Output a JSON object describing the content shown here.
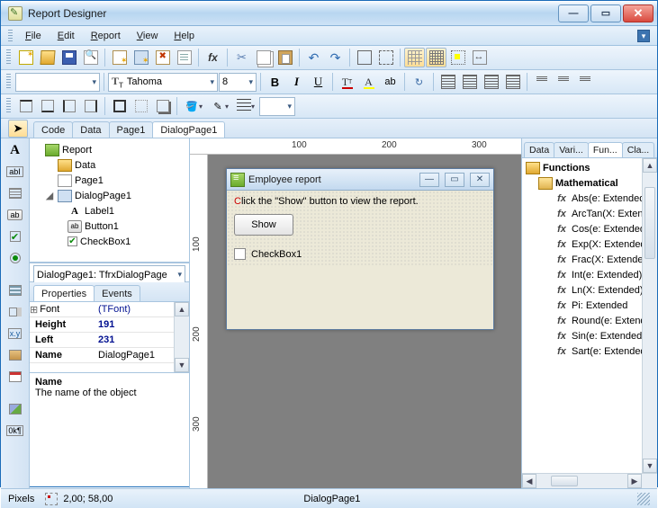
{
  "window": {
    "title": "Report Designer"
  },
  "menu": {
    "file": "File",
    "edit": "Edit",
    "report": "Report",
    "view": "View",
    "help": "Help"
  },
  "formatbar": {
    "font_name": "Tahoma",
    "font_size": "8",
    "bold": "B",
    "italic": "I",
    "underline": "U"
  },
  "tabs": {
    "code": "Code",
    "data": "Data",
    "page1": "Page1",
    "dialogpage1": "DialogPage1"
  },
  "tree": {
    "report": "Report",
    "data": "Data",
    "page1": "Page1",
    "dialogpage1": "DialogPage1",
    "label1": "Label1",
    "button1": "Button1",
    "checkbox1": "CheckBox1"
  },
  "object_selector": "DialogPage1: TfrxDialogPage",
  "proptabs": {
    "properties": "Properties",
    "events": "Events"
  },
  "props": {
    "font_k": "Font",
    "font_v": "(TFont)",
    "height_k": "Height",
    "height_v": "191",
    "left_k": "Left",
    "left_v": "231",
    "name_k": "Name",
    "name_v": "DialogPage1"
  },
  "propdesc": {
    "name": "Name",
    "text": "The name of the object"
  },
  "ruler": {
    "h100": "100",
    "h200": "200",
    "h300": "300",
    "v100": "100",
    "v200": "200",
    "v300": "300"
  },
  "dialog": {
    "title": "Employee report",
    "label": "lick the \"Show\" button to view the report.",
    "label_first": "C",
    "button": "Show",
    "checkbox": "CheckBox1"
  },
  "rightTabs": {
    "data": "Data",
    "variables": "Vari...",
    "functions": "Fun...",
    "classes": "Cla..."
  },
  "functions": {
    "root": "Functions",
    "group": "Mathematical",
    "items": [
      "Abs(e: Extended)",
      "ArcTan(X: Exten",
      "Cos(e: Extended)",
      "Exp(X: Extended",
      "Frac(X: Extended",
      "Int(e: Extended):",
      "Ln(X: Extended):",
      "Pi: Extended",
      "Round(e: Extend",
      "Sin(e: Extended)",
      "Sart(e: Extended"
    ]
  },
  "status": {
    "units": "Pixels",
    "pos": "2,00; 58,00",
    "object": "DialogPage1"
  }
}
